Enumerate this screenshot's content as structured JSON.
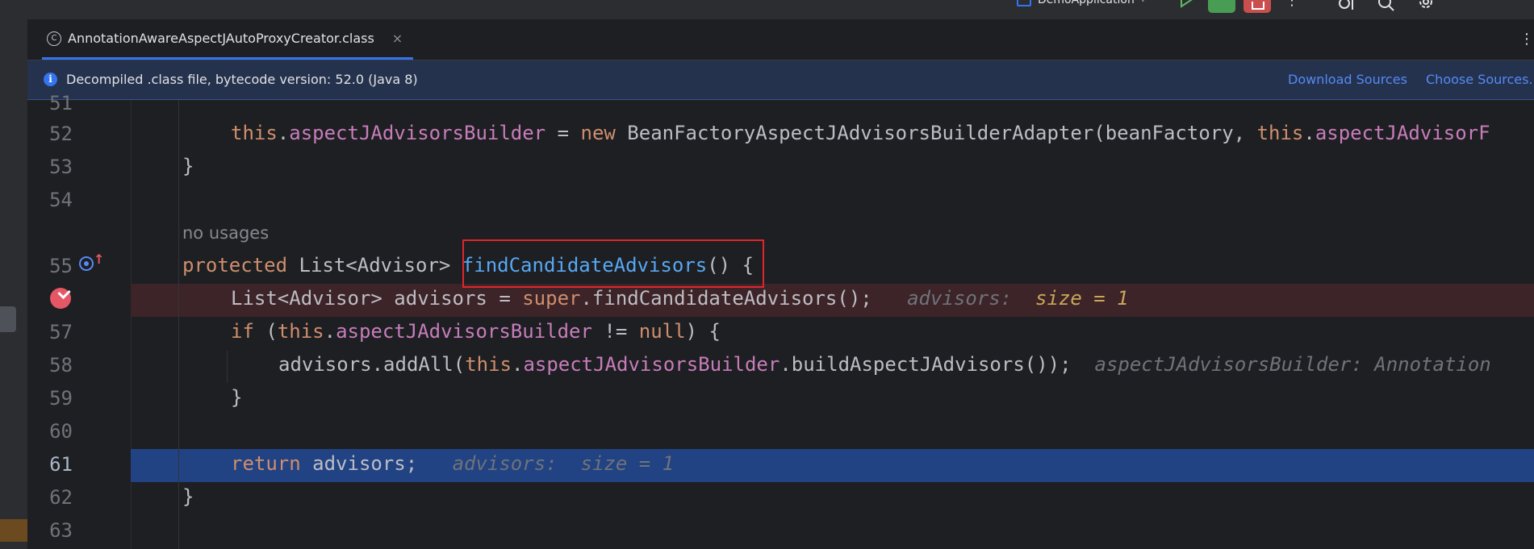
{
  "toolbar": {
    "run_config": "DemoApplication"
  },
  "tab": {
    "label": "AnnotationAwareAspectJAutoProxyCreator.class",
    "icon_letter": "C",
    "close": "×",
    "more": "⋮"
  },
  "banner": {
    "message": "Decompiled .class file, bytecode version: 52.0 (Java 8)",
    "download_sources": "Download Sources",
    "choose_sources": "Choose Sources..."
  },
  "editor": {
    "line_numbers": [
      "51",
      "52",
      "53",
      "54",
      "55",
      "56",
      "57",
      "58",
      "59",
      "60",
      "61",
      "62",
      "63"
    ],
    "usages_hint": "no usages",
    "line52": {
      "kw_this": "this",
      "field": "aspectJAdvisorsBuilder",
      "eq": " = ",
      "kw_new": "new",
      "rest": " BeanFactoryAspectJAdvisorsBuilderAdapter(beanFactory, ",
      "kw_this2": "this",
      "field2": "aspectJAdvisorF"
    },
    "line53": "}",
    "line55": {
      "kw": "protected",
      "type": " List<Advisor> ",
      "method": "findCandidateAdvisors",
      "rest": "() {"
    },
    "line56": {
      "code": "List<Advisor> advisors = ",
      "kw_super": "super",
      "call": ".findCandidateAdvisors();",
      "hint_name": "advisors:",
      "hint_value": "size = 1"
    },
    "line57": {
      "kw_if": "if",
      "open": " (",
      "kw_this": "this",
      "dot": ".",
      "field": "aspectJAdvisorsBuilder",
      "op": " != ",
      "kw_null": "null",
      "close": ") {"
    },
    "line58": {
      "code": "advisors.addAll(",
      "kw_this": "this",
      "dot": ".",
      "field": "aspectJAdvisorsBuilder",
      "call": ".buildAspectJAdvisors());",
      "hint": "aspectJAdvisorsBuilder: Annotation"
    },
    "line59": "}",
    "line61": {
      "kw_return": "return",
      "code": " advisors;",
      "hint_name": "advisors:",
      "hint_value": "size = 1"
    },
    "line62": "}"
  },
  "colors": {
    "keyword": "#cf8e6d",
    "field": "#c77dbb",
    "method": "#56a8f5",
    "highlight_box": "#e0262d",
    "execution_line": "#214283",
    "breakpoint_line": "#3d2428"
  }
}
